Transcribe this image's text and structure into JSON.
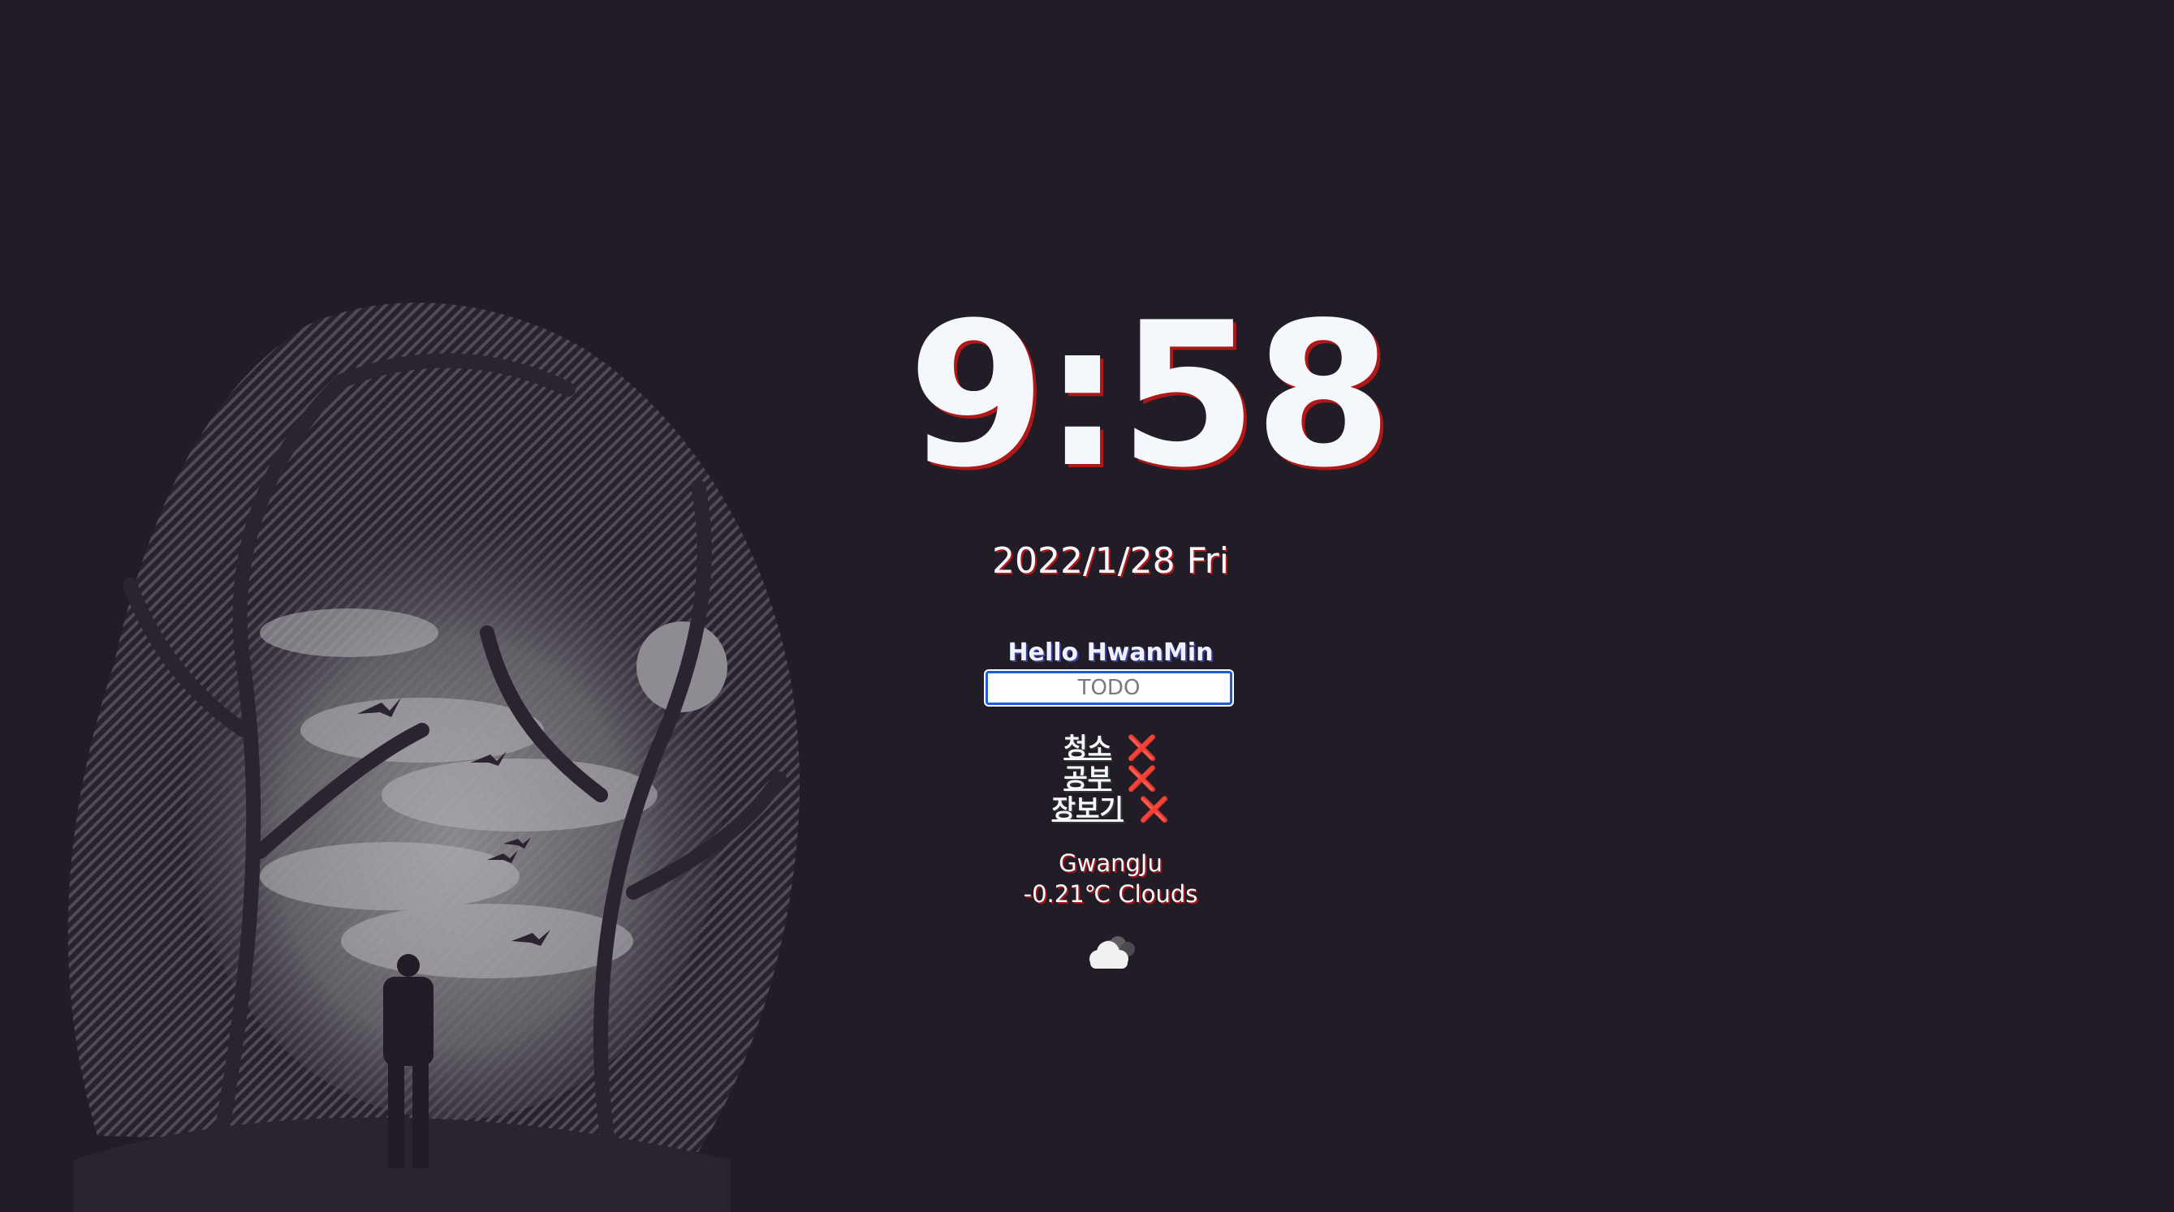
{
  "clock": {
    "time": "9:58"
  },
  "date": {
    "text": "2022/1/28 Fri"
  },
  "greeting": {
    "text": "Hello HwanMin"
  },
  "todo_form": {
    "placeholder": "TODO",
    "value": ""
  },
  "todos": [
    {
      "text": "청소",
      "delete_label": "❌"
    },
    {
      "text": "공부",
      "delete_label": "❌"
    },
    {
      "text": "장보기",
      "delete_label": "❌"
    }
  ],
  "weather": {
    "city": "GwangJu",
    "summary": "-0.21℃ Clouds",
    "icon": "cloud-icon"
  },
  "colors": {
    "background": "#221c27",
    "text": "#f4f8fc",
    "accent_shadow": "#b01818",
    "delete": "#e01010",
    "input_border": "#1d5fd6"
  }
}
